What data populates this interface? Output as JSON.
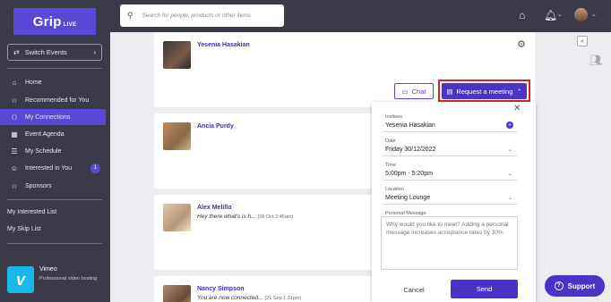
{
  "brand": {
    "name": "Grip",
    "suffix": "LIVE"
  },
  "sidebar": {
    "switch_label": "Switch Events",
    "items": [
      {
        "label": "Home",
        "icon": "home-icon"
      },
      {
        "label": "Recommended for You",
        "icon": "star-icon"
      },
      {
        "label": "My Connections",
        "icon": "connections-icon",
        "active": true
      },
      {
        "label": "Event Agenda",
        "icon": "calendar-icon"
      },
      {
        "label": "My Schedule",
        "icon": "schedule-icon"
      },
      {
        "label": "Interested in You",
        "icon": "smile-icon",
        "badge": "1"
      },
      {
        "label": "Sponsors",
        "icon": "star-outline-icon"
      }
    ],
    "links": [
      "My Interested List",
      "My Skip List"
    ],
    "sponsor": {
      "name": "Vimeo",
      "description": "Professional video hosting"
    }
  },
  "search": {
    "placeholder": "Search for people, products or other items"
  },
  "connections": [
    {
      "name": "Yesenia Hasakian",
      "message": "",
      "time": ""
    },
    {
      "name": "Ancia Purdy",
      "message": "",
      "time": ""
    },
    {
      "name": "Alex Melillo",
      "message": "Hey there what's is h...",
      "time": "(06 Oct 2:45am)"
    },
    {
      "name": "Nancy Simpson",
      "message": "You are now connected...",
      "time": "(21 Sep 1:31pm)"
    }
  ],
  "actions": {
    "chat_label": "Chat",
    "request_label": "Request a meeting"
  },
  "meeting_form": {
    "invitees_label": "Invitees",
    "invitees_value": "Yesenia Hasakian",
    "date_label": "Date",
    "date_value": "Friday 30/12/2022",
    "time_label": "Time",
    "time_value": "5:00pm - 5:20pm",
    "location_label": "Location",
    "location_value": "Meeting Lounge",
    "message_label": "Personal Message",
    "message_placeholder": "Why would you like to meet? Adding a personal message increases acceptance rates by 30%",
    "cancel_label": "Cancel",
    "send_label": "Send"
  },
  "support": {
    "label": "Support"
  },
  "colors": {
    "accent": "#4a34c8",
    "sidebar_bg": "#3b3a48",
    "highlight": "#e02020"
  }
}
